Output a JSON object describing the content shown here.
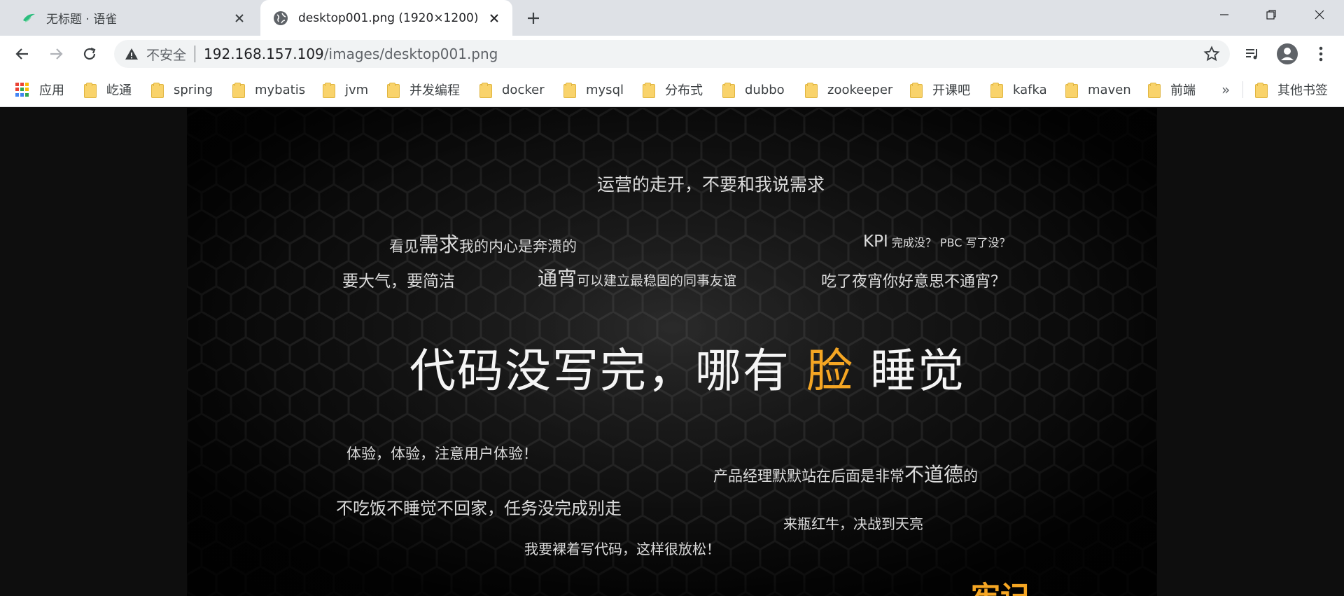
{
  "tabs": [
    {
      "title": "无标题 · 语雀",
      "active": false,
      "icon": "yuque-icon"
    },
    {
      "title": "desktop001.png (1920×1200)",
      "active": true,
      "icon": "globe-icon"
    }
  ],
  "toolbar": {
    "security_label": "不安全",
    "url_host": "192.168.157.109",
    "url_path": "/images/desktop001.png"
  },
  "bookmarks": [
    {
      "label": "应用",
      "icon": "apps-grid-icon"
    },
    {
      "label": "屹通",
      "icon": "folder-icon"
    },
    {
      "label": "spring",
      "icon": "folder-icon"
    },
    {
      "label": "mybatis",
      "icon": "folder-icon"
    },
    {
      "label": "jvm",
      "icon": "folder-icon"
    },
    {
      "label": "并发编程",
      "icon": "folder-icon"
    },
    {
      "label": "docker",
      "icon": "folder-icon"
    },
    {
      "label": "mysql",
      "icon": "folder-icon"
    },
    {
      "label": "分布式",
      "icon": "folder-icon"
    },
    {
      "label": "dubbo",
      "icon": "folder-icon"
    },
    {
      "label": "zookeeper",
      "icon": "folder-icon"
    },
    {
      "label": "开课吧",
      "icon": "folder-icon"
    },
    {
      "label": "kafka",
      "icon": "folder-icon"
    },
    {
      "label": "maven",
      "icon": "folder-icon"
    },
    {
      "label": "前端",
      "icon": "folder-icon"
    }
  ],
  "bookmarks_overflow": "»",
  "other_bookmarks": "其他书签",
  "wallpaper": {
    "p1": "运营的走开，不要和我说需求",
    "p2a": "看见",
    "p2b": "需求",
    "p2c": "我的内心是奔溃的",
    "p3a": "KPI",
    "p3b": " 完成没？ PBC 写了没？",
    "p4": "要大气，要简洁",
    "p5a": "通宵",
    "p5b": "可以建立最稳固的同事友谊",
    "p6": "吃了夜宵你好意思不通宵？",
    "main_a": "代码没写完，哪有",
    "main_b": "脸",
    "main_c": "睡觉",
    "p7": "体验，体验，注意用户体验！",
    "p8a": "产品经理默默站在后面是非常",
    "p8b": "不道德",
    "p8c": "的",
    "p9": "不吃饭不睡觉不回家，任务没完成别走",
    "p10": "来瓶红牛，决战到天亮",
    "p11": "我要裸着写代码，这样很放松！",
    "p12": "牢记"
  },
  "colors": {
    "accent": "#f5a623",
    "tabstrip": "#dee1e6",
    "omnibox": "#f1f3f4",
    "folder": "#f9d36b"
  }
}
